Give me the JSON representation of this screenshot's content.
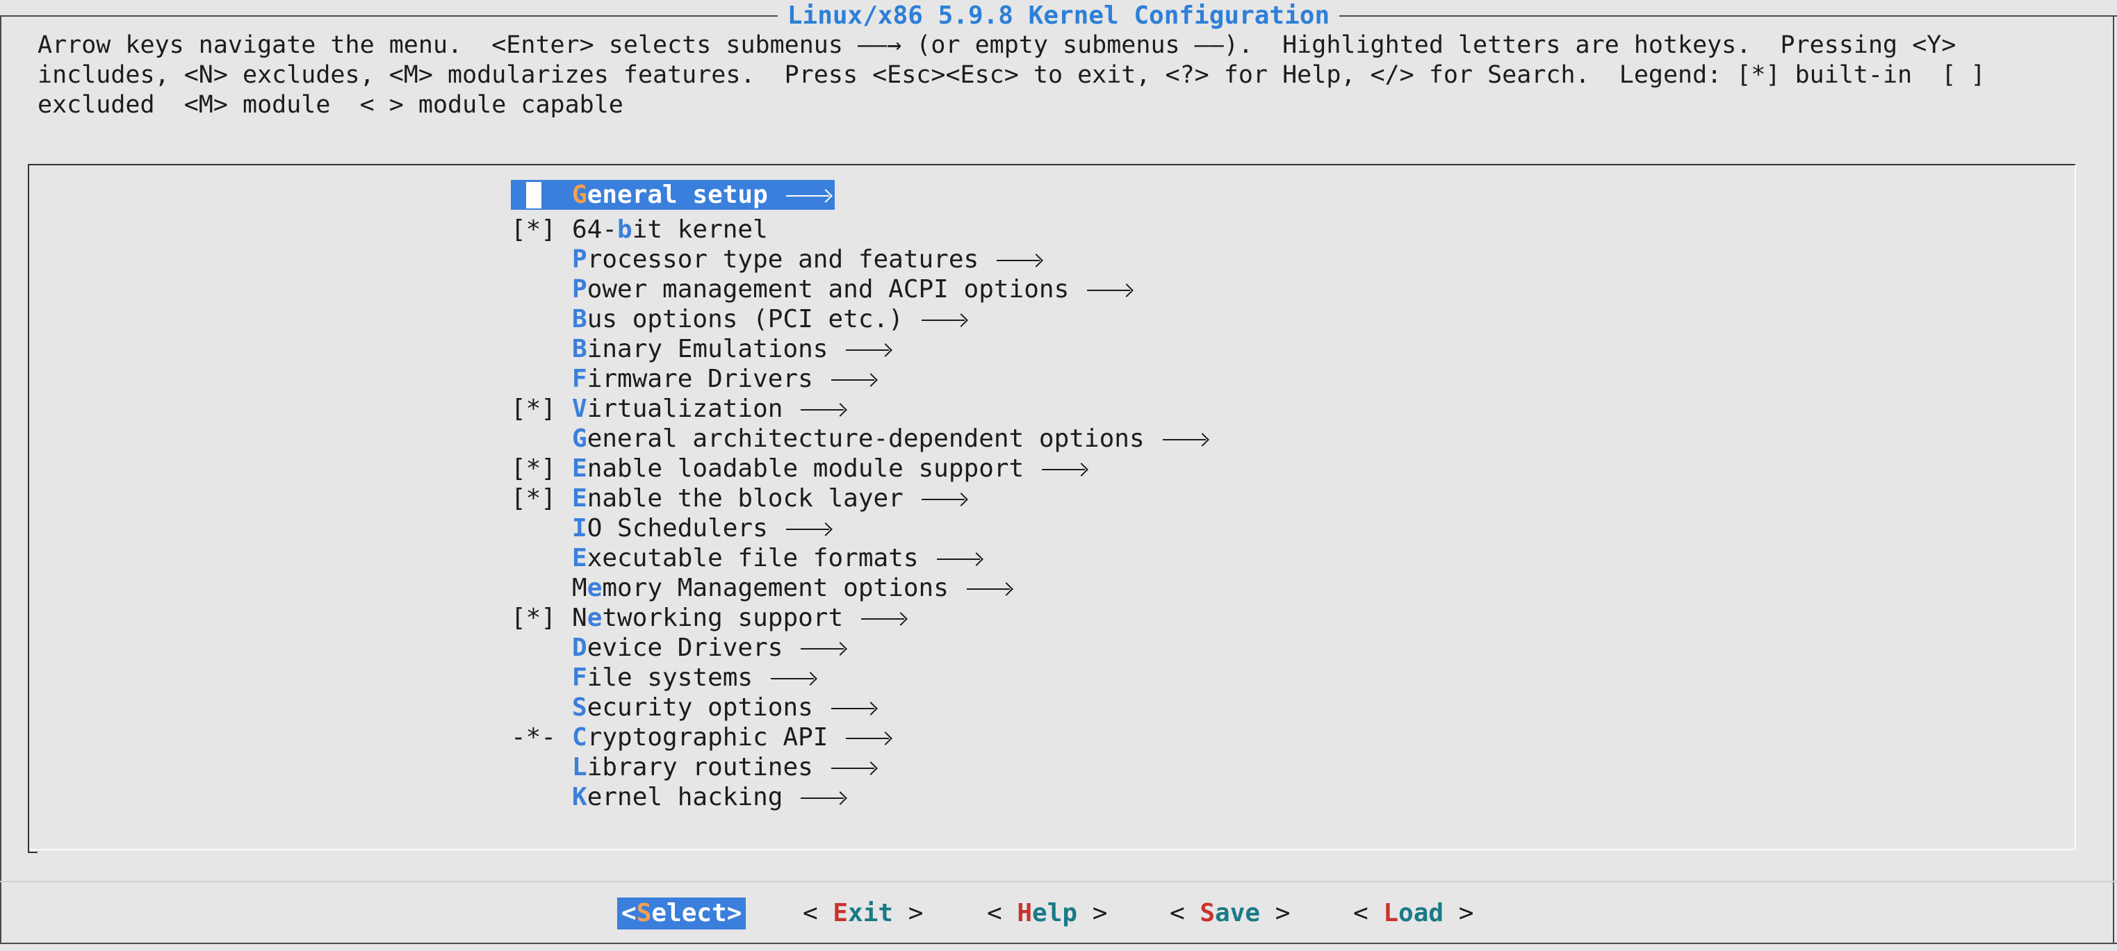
{
  "window": {
    "title": "Linux/x86 5.9.8 Kernel Configuration"
  },
  "instructions": "Arrow keys navigate the menu.  <Enter> selects submenus ——→ (or empty submenus ——).  Highlighted letters are hotkeys.  Pressing <Y> includes, <N> excludes, <M> modularizes features.  Press <Esc><Esc> to exit, <?> for Help, </> for Search.  Legend: [*] built-in  [ ] excluded  <M> module  < > module capable",
  "menu": {
    "items": [
      {
        "prefix": "",
        "hot": "G",
        "rest": "eneral setup",
        "pre": "",
        "submenu": true,
        "selected": true
      },
      {
        "prefix": "[*]",
        "pre": "64-",
        "hot": "b",
        "rest": "it kernel",
        "submenu": false
      },
      {
        "prefix": "",
        "pre": "",
        "hot": "P",
        "rest": "rocessor type and features",
        "submenu": true
      },
      {
        "prefix": "",
        "pre": "",
        "hot": "P",
        "rest": "ower management and ACPI options",
        "submenu": true
      },
      {
        "prefix": "",
        "pre": "",
        "hot": "B",
        "rest": "us options (PCI etc.)",
        "submenu": true
      },
      {
        "prefix": "",
        "pre": "",
        "hot": "B",
        "rest": "inary Emulations",
        "submenu": true
      },
      {
        "prefix": "",
        "pre": "",
        "hot": "F",
        "rest": "irmware Drivers",
        "submenu": true
      },
      {
        "prefix": "[*]",
        "pre": "",
        "hot": "V",
        "rest": "irtualization",
        "submenu": true
      },
      {
        "prefix": "",
        "pre": "",
        "hot": "G",
        "rest": "eneral architecture-dependent options",
        "submenu": true
      },
      {
        "prefix": "[*]",
        "pre": "",
        "hot": "E",
        "rest": "nable loadable module support",
        "submenu": true
      },
      {
        "prefix": "[*]",
        "pre": "",
        "hot": "E",
        "rest": "nable the block layer",
        "submenu": true
      },
      {
        "prefix": "",
        "pre": "",
        "hot": "I",
        "rest": "O Schedulers",
        "submenu": true
      },
      {
        "prefix": "",
        "pre": "",
        "hot": "E",
        "rest": "xecutable file formats",
        "submenu": true
      },
      {
        "prefix": "",
        "pre": "M",
        "hot": "e",
        "rest": "mory Management options",
        "submenu": true
      },
      {
        "prefix": "[*]",
        "pre": "N",
        "hot": "e",
        "rest": "tworking support",
        "submenu": true
      },
      {
        "prefix": "",
        "pre": "",
        "hot": "D",
        "rest": "evice Drivers",
        "submenu": true
      },
      {
        "prefix": "",
        "pre": "",
        "hot": "F",
        "rest": "ile systems",
        "submenu": true
      },
      {
        "prefix": "",
        "pre": "",
        "hot": "S",
        "rest": "ecurity options",
        "submenu": true
      },
      {
        "prefix": "-*-",
        "pre": "",
        "hot": "C",
        "rest": "ryptographic API",
        "submenu": true
      },
      {
        "prefix": "",
        "pre": "",
        "hot": "L",
        "rest": "ibrary routines",
        "submenu": true
      },
      {
        "prefix": "",
        "pre": "",
        "hot": "K",
        "rest": "ernel hacking",
        "submenu": true
      }
    ]
  },
  "buttons": [
    {
      "open": "<",
      "hot": "S",
      "rest": "elect",
      "close": ">",
      "active": true
    },
    {
      "open": "< ",
      "hot": "E",
      "rest": "xit",
      "close": " >",
      "active": false
    },
    {
      "open": "< ",
      "hot": "H",
      "rest": "elp",
      "close": " >",
      "active": false
    },
    {
      "open": "< ",
      "hot": "S",
      "rest": "ave",
      "close": " >",
      "active": false
    },
    {
      "open": "< ",
      "hot": "L",
      "rest": "oad",
      "close": " >",
      "active": false
    }
  ],
  "colors": {
    "accent": "#3a7fdc",
    "hotkey_selected": "#f4a050",
    "background": "#e6e6e6",
    "button_hot": "#c8332e",
    "button_text": "#1a7a86"
  }
}
